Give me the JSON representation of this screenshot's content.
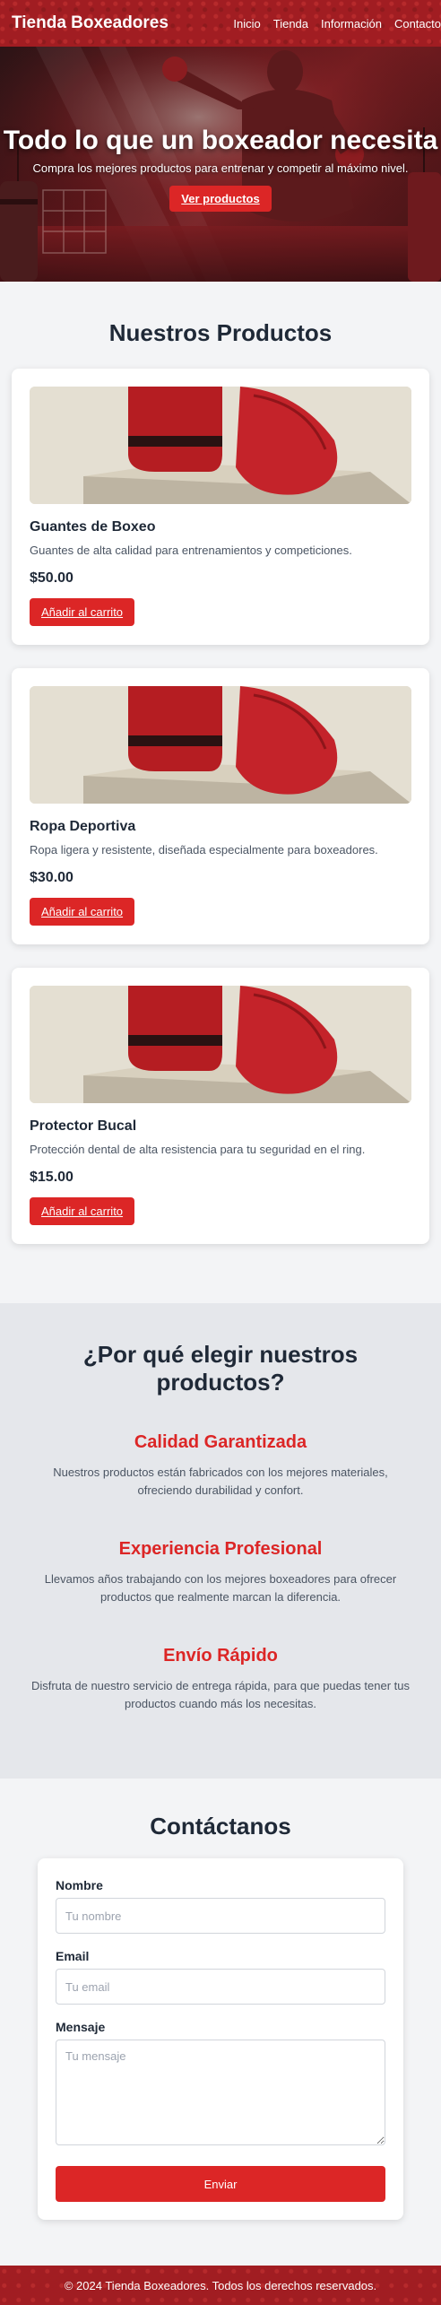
{
  "header": {
    "logo": "Tienda Boxeadores",
    "nav": [
      "Inicio",
      "Tienda",
      "Información",
      "Contacto"
    ]
  },
  "hero": {
    "title": "Todo lo que un boxeador necesita",
    "subtitle": "Compra los mejores productos para entrenar y competir al máximo nivel.",
    "button": "Ver productos"
  },
  "products": {
    "title": "Nuestros Productos",
    "items": [
      {
        "name": "Guantes de Boxeo",
        "description": "Guantes de alta calidad para entrenamientos y competiciones.",
        "price": "$50.00",
        "button": "Añadir al carrito"
      },
      {
        "name": "Ropa Deportiva",
        "description": "Ropa ligera y resistente, diseñada especialmente para boxeadores.",
        "price": "$30.00",
        "button": "Añadir al carrito"
      },
      {
        "name": "Protector Bucal",
        "description": "Protección dental de alta resistencia para tu seguridad en el ring.",
        "price": "$15.00",
        "button": "Añadir al carrito"
      }
    ]
  },
  "why": {
    "title": "¿Por qué elegir nuestros productos?",
    "features": [
      {
        "title": "Calidad Garantizada",
        "description": "Nuestros productos están fabricados con los mejores materiales, ofreciendo durabilidad y confort."
      },
      {
        "title": "Experiencia Profesional",
        "description": "Llevamos años trabajando con los mejores boxeadores para ofrecer productos que realmente marcan la diferencia."
      },
      {
        "title": "Envío Rápido",
        "description": "Disfruta de nuestro servicio de entrega rápida, para que puedas tener tus productos cuando más los necesitas."
      }
    ]
  },
  "contact": {
    "title": "Contáctanos",
    "name_label": "Nombre",
    "name_placeholder": "Tu nombre",
    "email_label": "Email",
    "email_placeholder": "Tu email",
    "message_label": "Mensaje",
    "message_placeholder": "Tu mensaje",
    "submit": "Enviar"
  },
  "footer": {
    "text": "© 2024 Tienda Boxeadores. Todos los derechos reservados."
  },
  "colors": {
    "brand_red": "#a11d22",
    "accent_red": "#dc2626"
  }
}
